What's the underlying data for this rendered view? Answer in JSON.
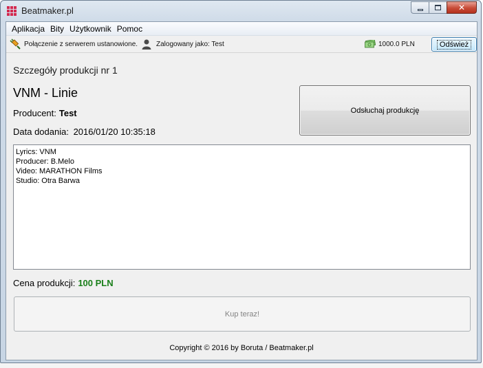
{
  "window": {
    "title": "Beatmaker.pl",
    "close_glyph": "✕"
  },
  "menu": {
    "items": [
      "Aplikacja",
      "Bity",
      "Użytkownik",
      "Pomoc"
    ]
  },
  "status": {
    "connection_icon": "plug-icon",
    "connection_text": "Połączenie z serwerem ustanowione.",
    "user_icon": "user-icon",
    "user_text": "Zalogowany jako: Test",
    "money_icon": "money-icon",
    "balance_text": "1000.0 PLN",
    "refresh_label": "Odśwież"
  },
  "details": {
    "header": "Szczegóły produkcji nr 1",
    "title": "VNM - Linie",
    "producer_label": "Producent:",
    "producer_value": "Test",
    "date_label": "Data dodania:",
    "date_value": "2016/01/20 10:35:18",
    "listen_label": "Odsłuchaj produkcję",
    "description_lines": [
      "Lyrics: VNM",
      "Producer: B.Melo",
      "Video: MARATHON Films",
      "Studio: Otra Barwa"
    ],
    "price_label": "Cena produkcji:",
    "price_value": "100 PLN",
    "buy_label": "Kup teraz!"
  },
  "footer": {
    "copyright": "Copyright © 2016 by Boruta / Beatmaker.pl"
  },
  "colors": {
    "price": "#1a7f1a",
    "app_icon": "#d3294f"
  }
}
